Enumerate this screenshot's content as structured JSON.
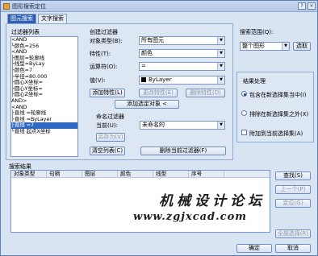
{
  "window": {
    "title": "图形搜索定位",
    "help": "?",
    "close": "×"
  },
  "tabs": [
    "图元搜索",
    "文字搜索"
  ],
  "filter_list": {
    "title": "过滤器列表",
    "items": [
      "<AND",
      "└颜色=256",
      "<AND",
      "├图层=轮廓线",
      "├线型=ByLay",
      "├颜色=7",
      "├半径=80.000",
      "├圆心X坐标=",
      "├圆心Y坐标=",
      "├圆心Z坐标=",
      "AND>",
      "<AND",
      "├直线 =轮廓线",
      "├直线 =ByLayer",
      "├直线 =7",
      "└直线 起点X坐标"
    ],
    "selected_index": 14
  },
  "create_filter": {
    "title": "创建过滤器",
    "object_type_label": "对象类型(B):",
    "object_type_value": "所有图元",
    "property_label": "特性(T):",
    "property_value": "颜色",
    "operator_label": "运算符(O):",
    "operator_value": "=",
    "value_label": "值(V):",
    "value_value": "ByLayer",
    "value_color": "#000000",
    "add_property": "添加特性(L)",
    "edit_property": "更改特性(E)",
    "delete_property": "删除特性(D)",
    "add_object": "添加选定对象 <"
  },
  "named_filter": {
    "title": "命名过滤器",
    "current_label": "当前(U):",
    "current_value": "未命名的",
    "save_as": "另存为(V)",
    "clear_list": "清空列表(C)",
    "delete_current": "删除当前过滤器(F)"
  },
  "search_scope": {
    "title": "搜索范围(Q):",
    "value": "整个图形",
    "select": "选取"
  },
  "result_processing": {
    "title": "结果处理",
    "options": [
      "包含在新选择集当中(I)",
      "排除在新选择集之外(X)"
    ],
    "selected": 0,
    "append_label": "附加到当前选择集(A)"
  },
  "search_results": {
    "title": "搜索结果",
    "columns": [
      "对象类型",
      "句柄",
      "图层",
      "颜色",
      "线型",
      "序号"
    ]
  },
  "side_buttons": {
    "search": "查找(S)",
    "prev": "上一个(P)",
    "locate": "定位(G)",
    "all_select": "全部选择(R)"
  },
  "footer": {
    "ok": "确定",
    "cancel": "取消"
  },
  "watermark": {
    "title": "机械设计论坛",
    "url": "www.zgjxcad.com"
  }
}
